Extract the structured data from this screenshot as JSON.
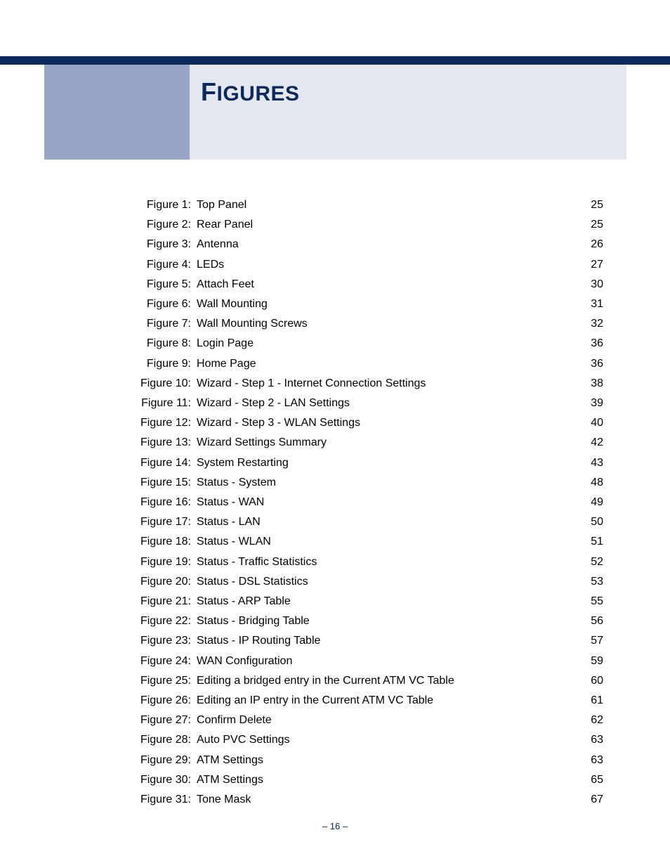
{
  "title_first": "F",
  "title_rest": "IGURES",
  "footer": "–  16  –",
  "figures": [
    {
      "label": "Figure 1:",
      "desc": "Top Panel",
      "page": "25"
    },
    {
      "label": "Figure 2:",
      "desc": "Rear Panel",
      "page": "25"
    },
    {
      "label": "Figure 3:",
      "desc": "Antenna",
      "page": "26"
    },
    {
      "label": "Figure 4:",
      "desc": "LEDs",
      "page": "27"
    },
    {
      "label": "Figure 5:",
      "desc": "Attach Feet",
      "page": "30"
    },
    {
      "label": "Figure 6:",
      "desc": "Wall Mounting",
      "page": "31"
    },
    {
      "label": "Figure 7:",
      "desc": "Wall Mounting Screws",
      "page": "32"
    },
    {
      "label": "Figure 8:",
      "desc": "Login Page",
      "page": "36"
    },
    {
      "label": "Figure 9:",
      "desc": "Home Page",
      "page": "36"
    },
    {
      "label": "Figure 10:",
      "desc": "Wizard - Step 1 - Internet Connection Settings",
      "page": "38"
    },
    {
      "label": "Figure 11:",
      "desc": "Wizard - Step 2 - LAN Settings",
      "page": "39"
    },
    {
      "label": "Figure 12:",
      "desc": "Wizard - Step 3 - WLAN Settings",
      "page": "40"
    },
    {
      "label": "Figure 13:",
      "desc": "Wizard Settings Summary",
      "page": "42"
    },
    {
      "label": "Figure 14:",
      "desc": "System Restarting",
      "page": "43"
    },
    {
      "label": "Figure 15:",
      "desc": "Status - System",
      "page": "48"
    },
    {
      "label": "Figure 16:",
      "desc": "Status - WAN",
      "page": "49"
    },
    {
      "label": "Figure 17:",
      "desc": "Status - LAN",
      "page": "50"
    },
    {
      "label": "Figure 18:",
      "desc": "Status - WLAN",
      "page": "51"
    },
    {
      "label": "Figure 19:",
      "desc": "Status - Traffic Statistics",
      "page": "52"
    },
    {
      "label": "Figure 20:",
      "desc": "Status - DSL Statistics",
      "page": "53"
    },
    {
      "label": "Figure 21:",
      "desc": "Status - ARP Table",
      "page": "55"
    },
    {
      "label": "Figure 22:",
      "desc": "Status - Bridging Table",
      "page": "56"
    },
    {
      "label": "Figure 23:",
      "desc": "Status - IP Routing Table",
      "page": "57"
    },
    {
      "label": "Figure 24:",
      "desc": "WAN Configuration",
      "page": "59"
    },
    {
      "label": "Figure 25:",
      "desc": "Editing a bridged entry in the Current ATM VC Table",
      "page": "60"
    },
    {
      "label": "Figure 26:",
      "desc": "Editing an IP entry in the Current ATM VC Table",
      "page": "61"
    },
    {
      "label": "Figure 27:",
      "desc": "Confirm Delete",
      "page": "62"
    },
    {
      "label": "Figure 28:",
      "desc": "Auto PVC Settings",
      "page": "63"
    },
    {
      "label": "Figure 29:",
      "desc": "ATM Settings",
      "page": "63"
    },
    {
      "label": "Figure 30:",
      "desc": "ATM Settings",
      "page": "65"
    },
    {
      "label": "Figure 31:",
      "desc": "Tone Mask",
      "page": "67"
    }
  ]
}
